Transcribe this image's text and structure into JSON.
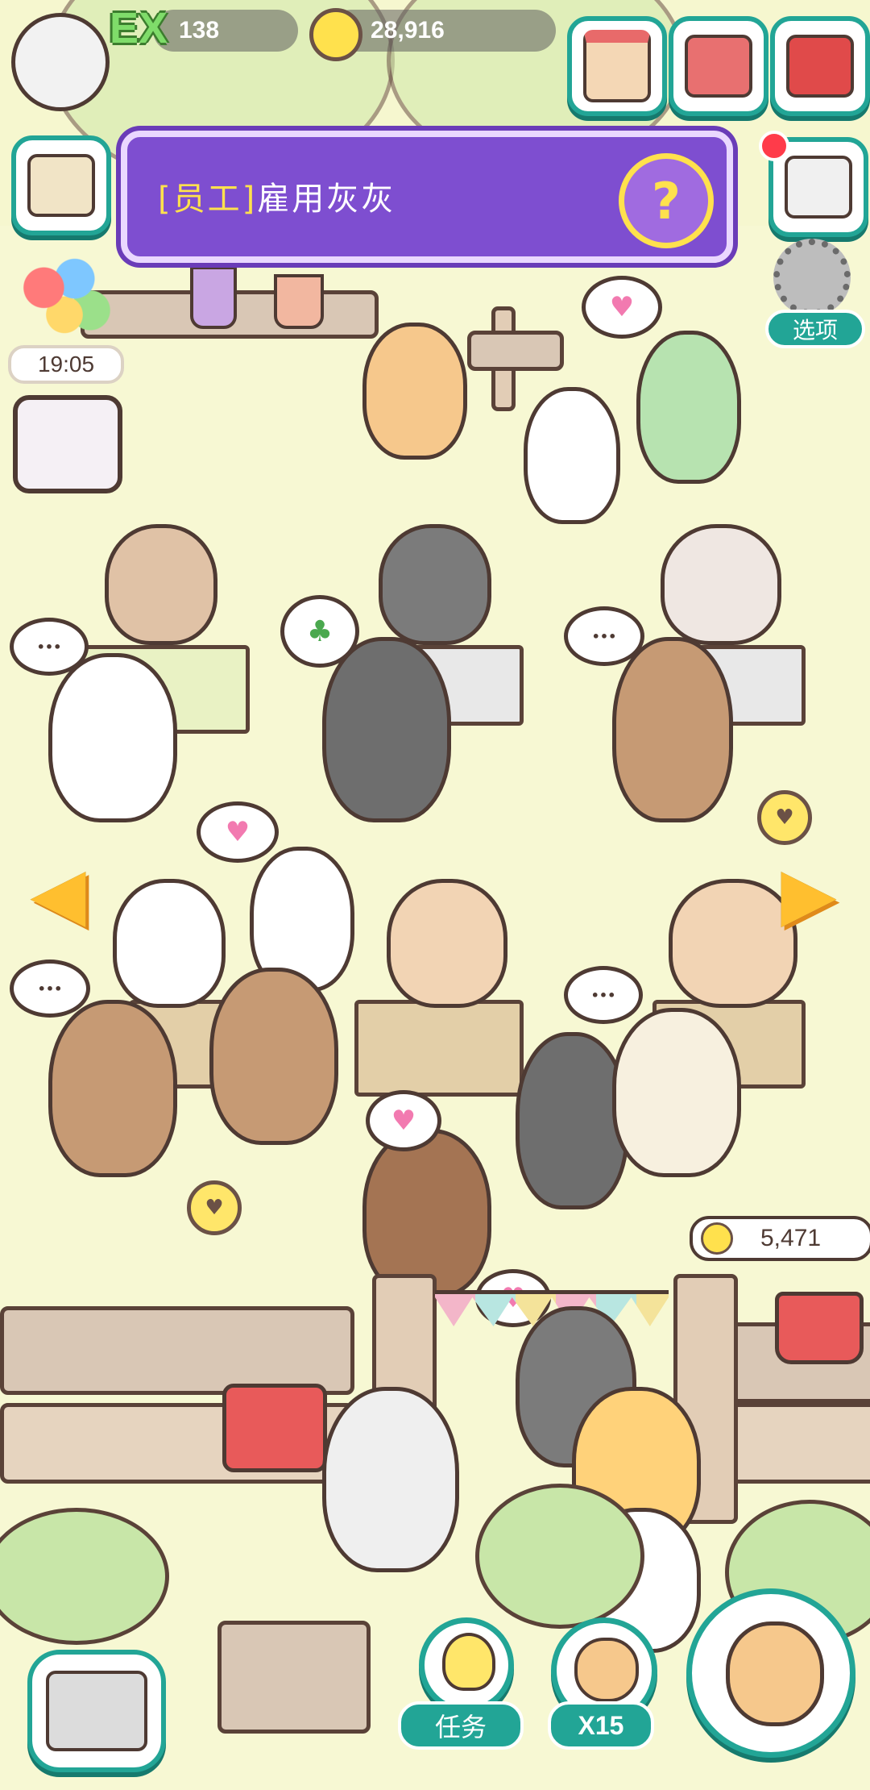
{
  "hud": {
    "exp_badge": "EX",
    "exp_value": "138",
    "coins_value": "28,916",
    "top_buttons": [
      "shop-icon",
      "album-icon",
      "mailbox-icon"
    ],
    "storage_has_notification": true,
    "settings_label": "选项",
    "timer": "19:05"
  },
  "banner": {
    "tag": "[员工]",
    "text": "雇用灰灰",
    "help_symbol": "?"
  },
  "navigation": {
    "left_arrow": "arrow-left-icon",
    "right_arrow": "arrow-right-icon"
  },
  "collect": {
    "amount": "5,471"
  },
  "bottom": {
    "tasks_label": "任务",
    "multiplier_label": "X15"
  },
  "bubbles": {
    "ellipsis": "•••"
  },
  "colors": {
    "teal": "#22a596",
    "banner_purple": "#7e4ed0",
    "banner_tag_yellow": "#ffe14d",
    "ground": "#f7f8d3"
  }
}
